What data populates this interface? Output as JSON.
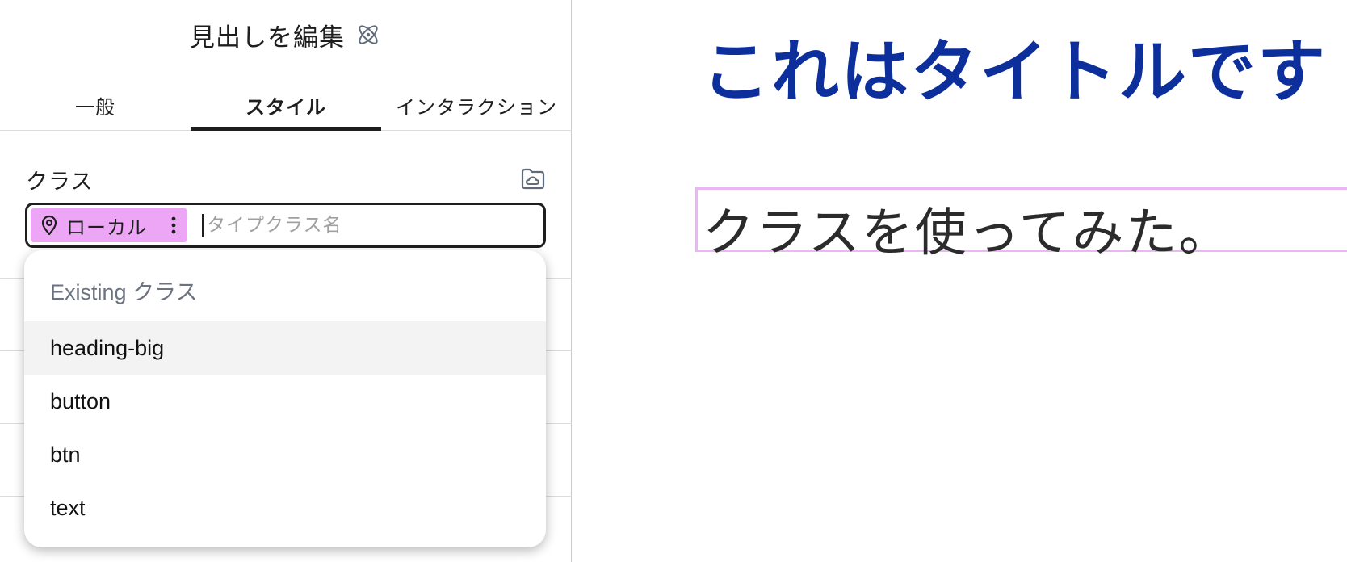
{
  "panel": {
    "title": "見出しを編集",
    "title_icon": "react-atom-icon",
    "tabs": [
      {
        "label": "一般",
        "active": false
      },
      {
        "label": "スタイル",
        "active": true
      },
      {
        "label": "インタラクション",
        "active": false
      }
    ],
    "class_section": {
      "label": "クラス",
      "manage_icon": "folder-cloud-icon",
      "chip": {
        "label": "ローカル",
        "icon": "map-pin-icon",
        "menu_icon": "vertical-dots-icon",
        "color": "#eca6f5"
      },
      "input_placeholder": "タイプクラス名",
      "input_value": ""
    },
    "dropdown": {
      "heading": "Existing クラス",
      "items": [
        {
          "label": "heading-big",
          "highlighted": true
        },
        {
          "label": "button",
          "highlighted": false
        },
        {
          "label": "btn",
          "highlighted": false
        },
        {
          "label": "text",
          "highlighted": false
        }
      ]
    }
  },
  "canvas": {
    "heading": "これはタイトルです",
    "heading_color": "#0d2f9c",
    "paragraph": "クラスを使ってみた。",
    "selection_outline_color": "#eab6f3"
  }
}
